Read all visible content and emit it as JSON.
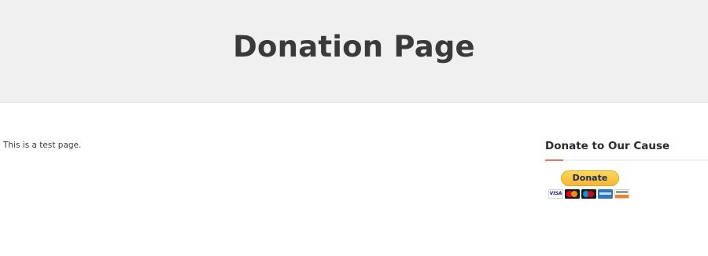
{
  "hero": {
    "title": "Donation Page"
  },
  "content": {
    "text": "This is a test page."
  },
  "sidebar": {
    "widget_title": "Donate to Our Cause",
    "donate_button_label": "Donate",
    "card_logos": [
      {
        "name": "visa-card-icon",
        "label": "VISA"
      },
      {
        "name": "mastercard-icon"
      },
      {
        "name": "maestro-card-icon"
      },
      {
        "name": "amex-card-icon"
      },
      {
        "name": "discover-card-icon"
      }
    ]
  },
  "colors": {
    "hero_background": "#f0f0f0",
    "heading_text": "#3a3a3a",
    "accent_underline": "#e07a5f",
    "donate_button": "#ffc439"
  }
}
